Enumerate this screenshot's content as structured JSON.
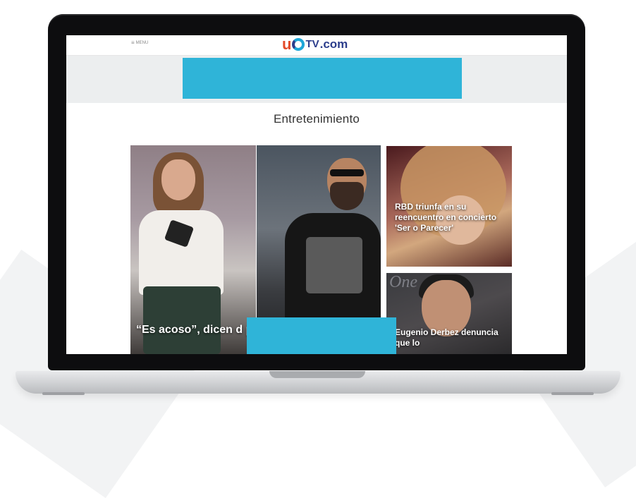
{
  "colors": {
    "accent_ad": "#2fb4d8",
    "logo_orange": "#e34b2a",
    "logo_blue": "#2c3e8c",
    "logo_cyan": "#1da6d8",
    "laptop_bezel": "#0d0d0f"
  },
  "header": {
    "menu_icon": "hamburger-icon",
    "menu_label": "MENU",
    "logo": {
      "u": "u",
      "tv": "TV",
      "domain": ".com"
    }
  },
  "section": {
    "title": "Entretenimiento"
  },
  "cards": [
    {
      "title": "“Es acoso”, dicen d polémico mensaje"
    },
    {
      "title": "RBD triunfa en su reencuentro en concierto 'Ser o Parecer'"
    },
    {
      "title": "Eugenio Derbez denuncia que lo",
      "image_text": "One"
    }
  ]
}
